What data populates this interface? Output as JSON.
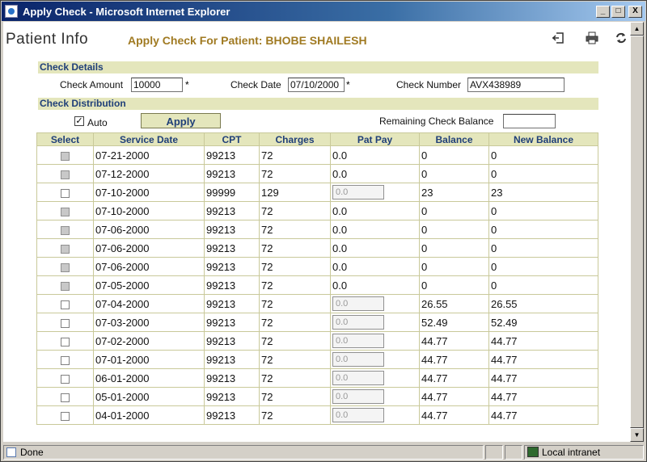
{
  "window": {
    "title": "Apply Check - Microsoft Internet Explorer",
    "minimize": "_",
    "maximize": "□",
    "close": "X"
  },
  "header": {
    "patient_info": "Patient Info",
    "apply_heading": "Apply Check For Patient: BHOBE SHAILESH",
    "icons": [
      "exit-icon",
      "print-icon",
      "refresh-icon"
    ]
  },
  "check_details": {
    "section_title": "Check Details",
    "amount_label": "Check Amount",
    "amount_value": "10000",
    "date_label": "Check Date",
    "date_value": "07/10/2000",
    "number_label": "Check Number",
    "number_value": "AVX438989",
    "required_mark": "*"
  },
  "check_distribution": {
    "section_title": "Check Distribution",
    "auto_label": "Auto",
    "auto_checked": true,
    "apply_label": "Apply",
    "remaining_label": "Remaining Check Balance",
    "remaining_value": ""
  },
  "table": {
    "headers": [
      "Select",
      "Service Date",
      "CPT",
      "Charges",
      "Pat Pay",
      "Balance",
      "New Balance"
    ],
    "rows": [
      {
        "enabled": false,
        "date": "07-21-2000",
        "cpt": "99213",
        "charges": "72",
        "pat_pay": "0.0",
        "pay_input": false,
        "balance": "0",
        "new_balance": "0"
      },
      {
        "enabled": false,
        "date": "07-12-2000",
        "cpt": "99213",
        "charges": "72",
        "pat_pay": "0.0",
        "pay_input": false,
        "balance": "0",
        "new_balance": "0"
      },
      {
        "enabled": true,
        "date": "07-10-2000",
        "cpt": "99999",
        "charges": "129",
        "pat_pay": "0.0",
        "pay_input": true,
        "balance": "23",
        "new_balance": "23"
      },
      {
        "enabled": false,
        "date": "07-10-2000",
        "cpt": "99213",
        "charges": "72",
        "pat_pay": "0.0",
        "pay_input": false,
        "balance": "0",
        "new_balance": "0"
      },
      {
        "enabled": false,
        "date": "07-06-2000",
        "cpt": "99213",
        "charges": "72",
        "pat_pay": "0.0",
        "pay_input": false,
        "balance": "0",
        "new_balance": "0"
      },
      {
        "enabled": false,
        "date": "07-06-2000",
        "cpt": "99213",
        "charges": "72",
        "pat_pay": "0.0",
        "pay_input": false,
        "balance": "0",
        "new_balance": "0"
      },
      {
        "enabled": false,
        "date": "07-06-2000",
        "cpt": "99213",
        "charges": "72",
        "pat_pay": "0.0",
        "pay_input": false,
        "balance": "0",
        "new_balance": "0"
      },
      {
        "enabled": false,
        "date": "07-05-2000",
        "cpt": "99213",
        "charges": "72",
        "pat_pay": "0.0",
        "pay_input": false,
        "balance": "0",
        "new_balance": "0"
      },
      {
        "enabled": true,
        "date": "07-04-2000",
        "cpt": "99213",
        "charges": "72",
        "pat_pay": "0.0",
        "pay_input": true,
        "balance": "26.55",
        "new_balance": "26.55"
      },
      {
        "enabled": true,
        "date": "07-03-2000",
        "cpt": "99213",
        "charges": "72",
        "pat_pay": "0.0",
        "pay_input": true,
        "balance": "52.49",
        "new_balance": "52.49"
      },
      {
        "enabled": true,
        "date": "07-02-2000",
        "cpt": "99213",
        "charges": "72",
        "pat_pay": "0.0",
        "pay_input": true,
        "balance": "44.77",
        "new_balance": "44.77"
      },
      {
        "enabled": true,
        "date": "07-01-2000",
        "cpt": "99213",
        "charges": "72",
        "pat_pay": "0.0",
        "pay_input": true,
        "balance": "44.77",
        "new_balance": "44.77"
      },
      {
        "enabled": true,
        "date": "06-01-2000",
        "cpt": "99213",
        "charges": "72",
        "pat_pay": "0.0",
        "pay_input": true,
        "balance": "44.77",
        "new_balance": "44.77"
      },
      {
        "enabled": true,
        "date": "05-01-2000",
        "cpt": "99213",
        "charges": "72",
        "pat_pay": "0.0",
        "pay_input": true,
        "balance": "44.77",
        "new_balance": "44.77"
      },
      {
        "enabled": true,
        "date": "04-01-2000",
        "cpt": "99213",
        "charges": "72",
        "pat_pay": "0.0",
        "pay_input": true,
        "balance": "44.77",
        "new_balance": "44.77"
      }
    ]
  },
  "statusbar": {
    "status": "Done",
    "zone": "Local intranet"
  }
}
